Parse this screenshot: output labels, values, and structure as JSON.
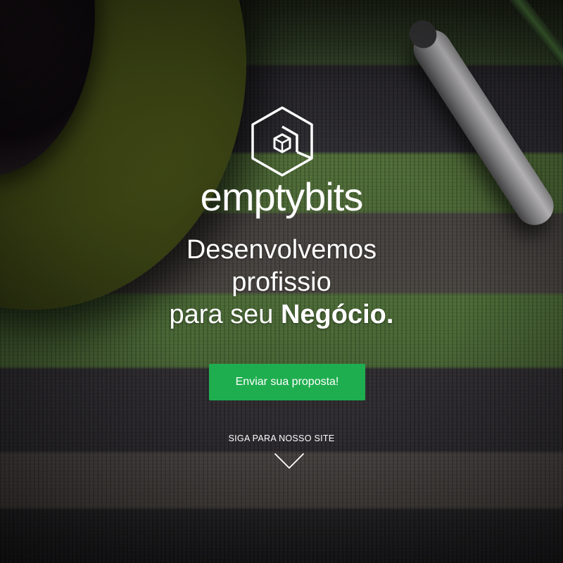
{
  "brand": {
    "name_light": "empty",
    "name_bold": "bits",
    "logo_icon": "hexagon-cube-icon"
  },
  "headline": {
    "line1": "Desenvolvemos",
    "line2": "profissio",
    "line3_prefix": "para seu",
    "line3_emphasis": "Negócio."
  },
  "cta": {
    "label": "Enviar sua proposta!",
    "color": "#1fae4f"
  },
  "scroll": {
    "label": "SIGA PARA NOSSO SITE",
    "icon": "chevron-down-icon"
  }
}
